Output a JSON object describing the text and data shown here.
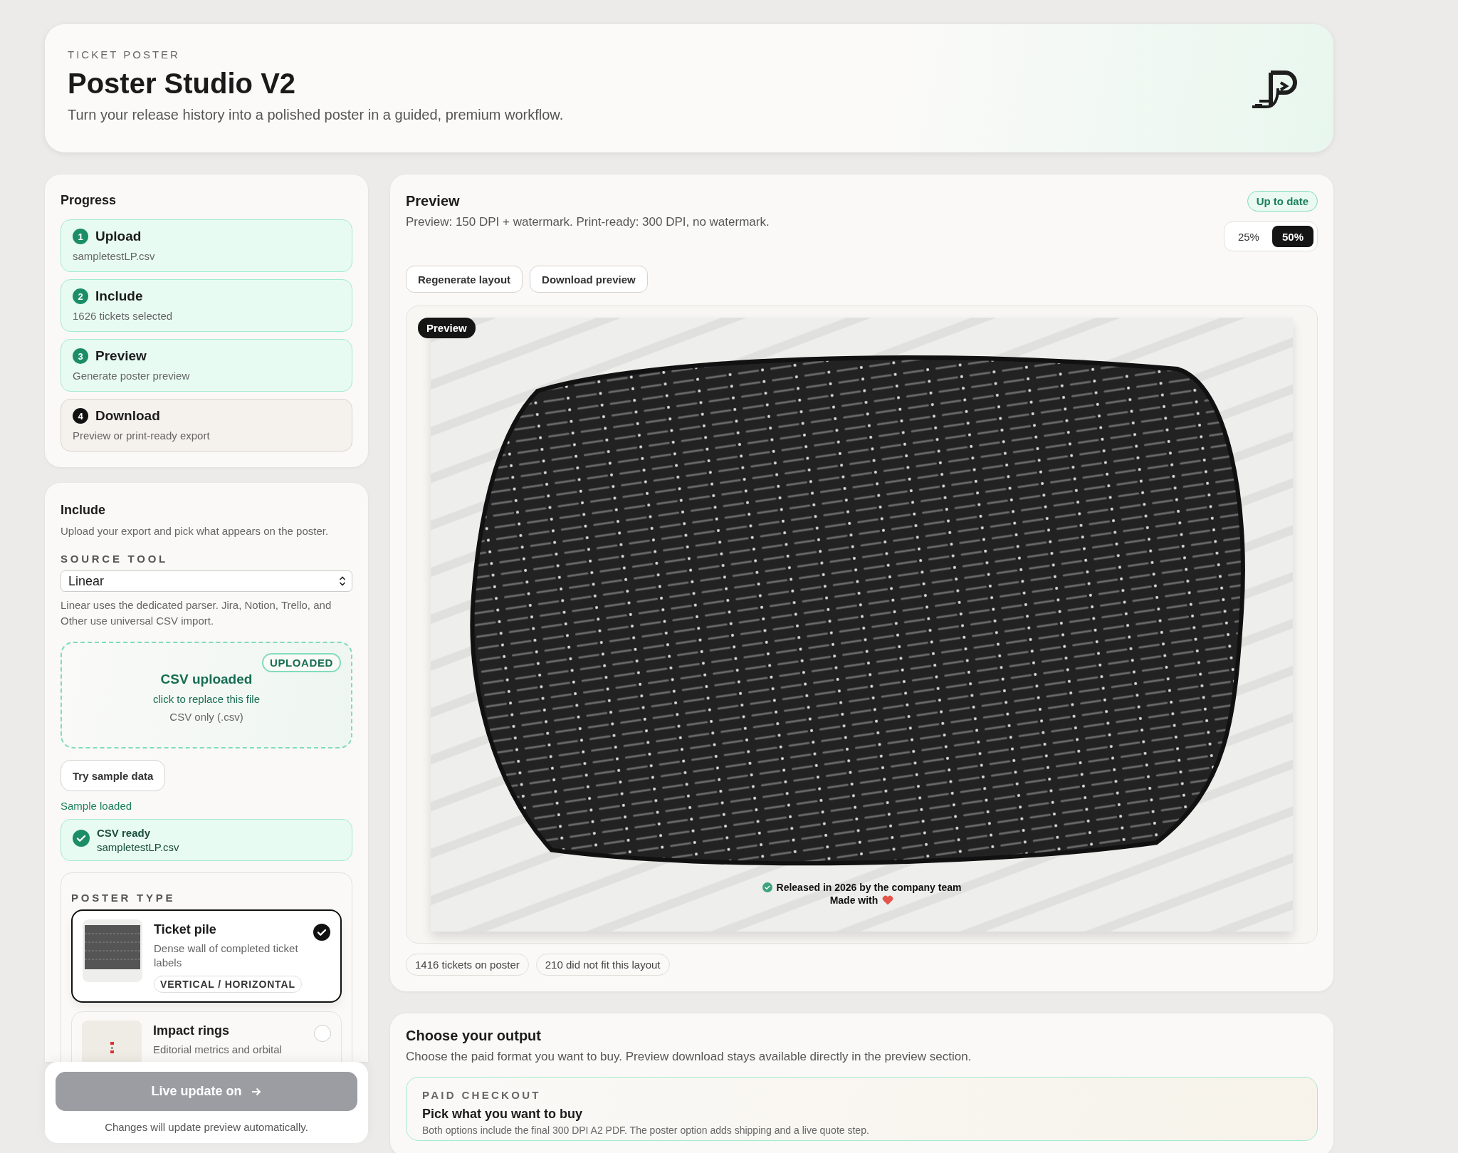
{
  "header": {
    "eyebrow": "TICKET POSTER",
    "title": "Poster Studio V2",
    "subtitle": "Turn your release history into a polished poster in a guided, premium workflow."
  },
  "progress": {
    "title": "Progress",
    "steps": [
      {
        "number": "1",
        "label": "Upload",
        "detail": "sampletestLP.csv",
        "done": true
      },
      {
        "number": "2",
        "label": "Include",
        "detail": "1626 tickets selected",
        "done": true
      },
      {
        "number": "3",
        "label": "Preview",
        "detail": "Generate poster preview",
        "done": true
      },
      {
        "number": "4",
        "label": "Download",
        "detail": "Preview or print-ready export",
        "done": false
      }
    ]
  },
  "include": {
    "title": "Include",
    "description": "Upload your export and pick what appears on the poster.",
    "source_tool": {
      "label": "SOURCE TOOL",
      "value": "Linear",
      "hint": "Linear uses the dedicated parser. Jira, Notion, Trello, and Other use universal CSV import."
    },
    "dropzone": {
      "badge": "UPLOADED",
      "title": "CSV uploaded",
      "action": "click to replace this file",
      "note": "CSV only (.csv)"
    },
    "sample_button": "Try sample data",
    "sample_status": "Sample loaded",
    "file_status": {
      "title": "CSV ready",
      "file": "sampletestLP.csv"
    },
    "poster_type": {
      "label": "POSTER TYPE",
      "options": [
        {
          "kind": "pile",
          "title": "Ticket pile",
          "description": "Dense wall of completed ticket labels",
          "tag": "VERTICAL / HORIZONTAL",
          "selected": true
        },
        {
          "kind": "rings",
          "title": "Impact rings",
          "description": "Editorial metrics and orbital",
          "selected": false
        }
      ]
    }
  },
  "live_update": {
    "button": "Live update on",
    "note": "Changes will update preview automatically."
  },
  "preview": {
    "title": "Preview",
    "subtitle": "Preview: 150 DPI + watermark. Print-ready: 300 DPI, no watermark.",
    "status": "Up to date",
    "zoom": [
      {
        "label": "25%",
        "selected": false
      },
      {
        "label": "50%",
        "selected": true
      }
    ],
    "actions": [
      "Regenerate layout",
      "Download preview"
    ],
    "badge": "Preview",
    "poster": {
      "credit": "Released in 2026 by the company team",
      "made_with": "Made with"
    },
    "stats": [
      "1416 tickets on poster",
      "210 did not fit this layout"
    ]
  },
  "output": {
    "title": "Choose your output",
    "subtitle": "Choose the paid format you want to buy. Preview download stays available directly in the preview section.",
    "checkout": {
      "eyebrow": "PAID CHECKOUT",
      "title": "Pick what you want to buy",
      "text": "Both options include the final 300 DPI A2 PDF. The poster option adds shipping and a live quote step."
    }
  }
}
